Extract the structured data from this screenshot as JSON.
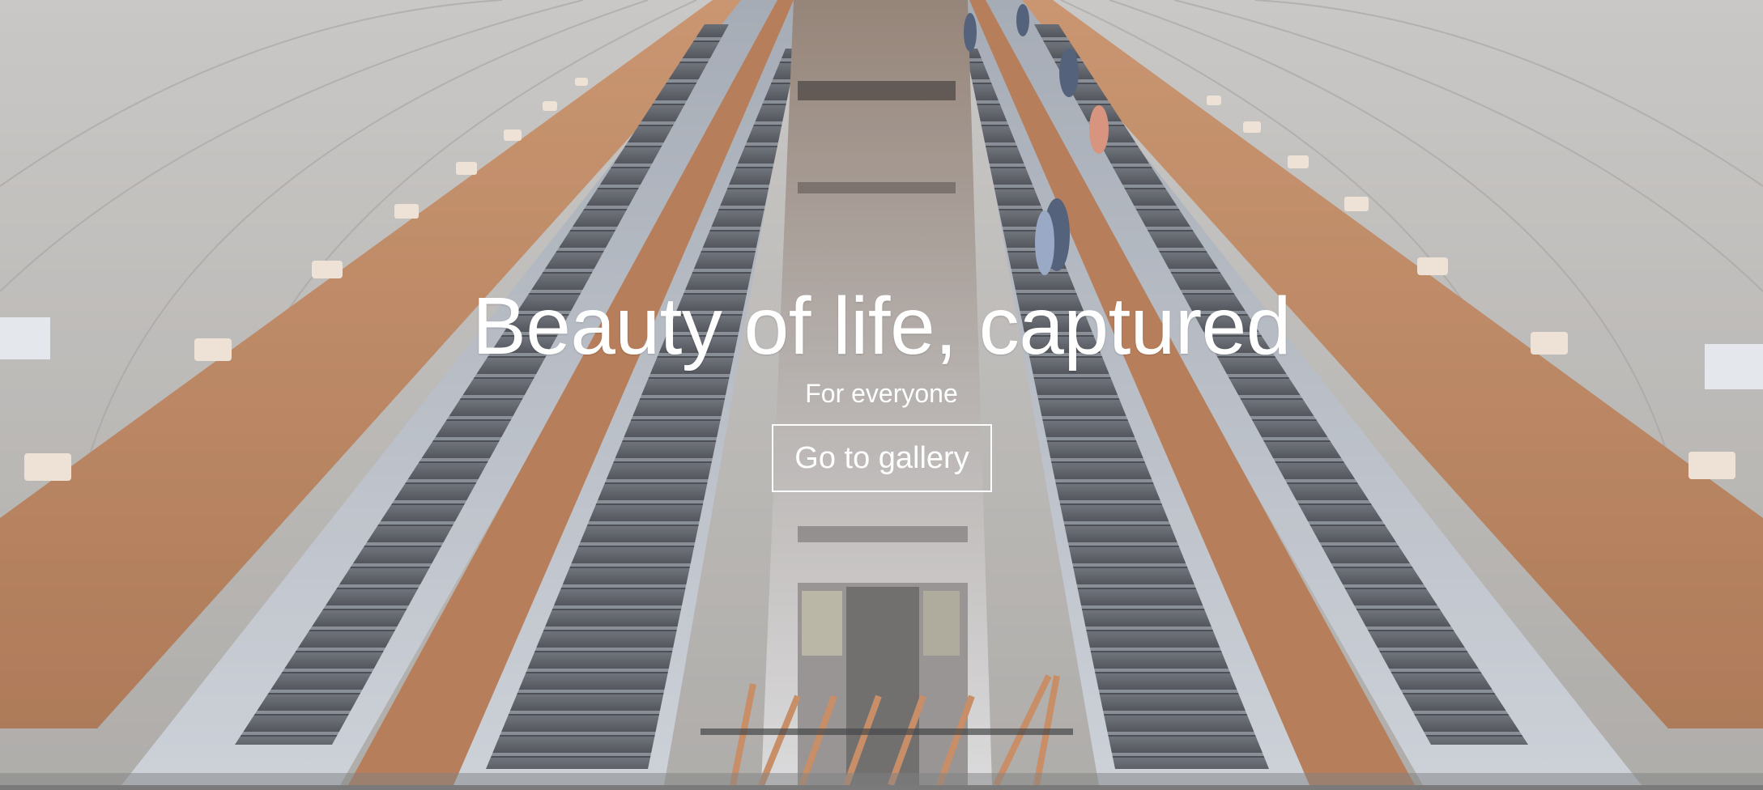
{
  "hero": {
    "title": "Beauty of life, captured",
    "subtitle": "For everyone",
    "cta_label": "Go to gallery",
    "background_image": "escalator-tunnel-photo",
    "text_color": "#ffffff",
    "overlay_color": "#cdd2dc"
  }
}
